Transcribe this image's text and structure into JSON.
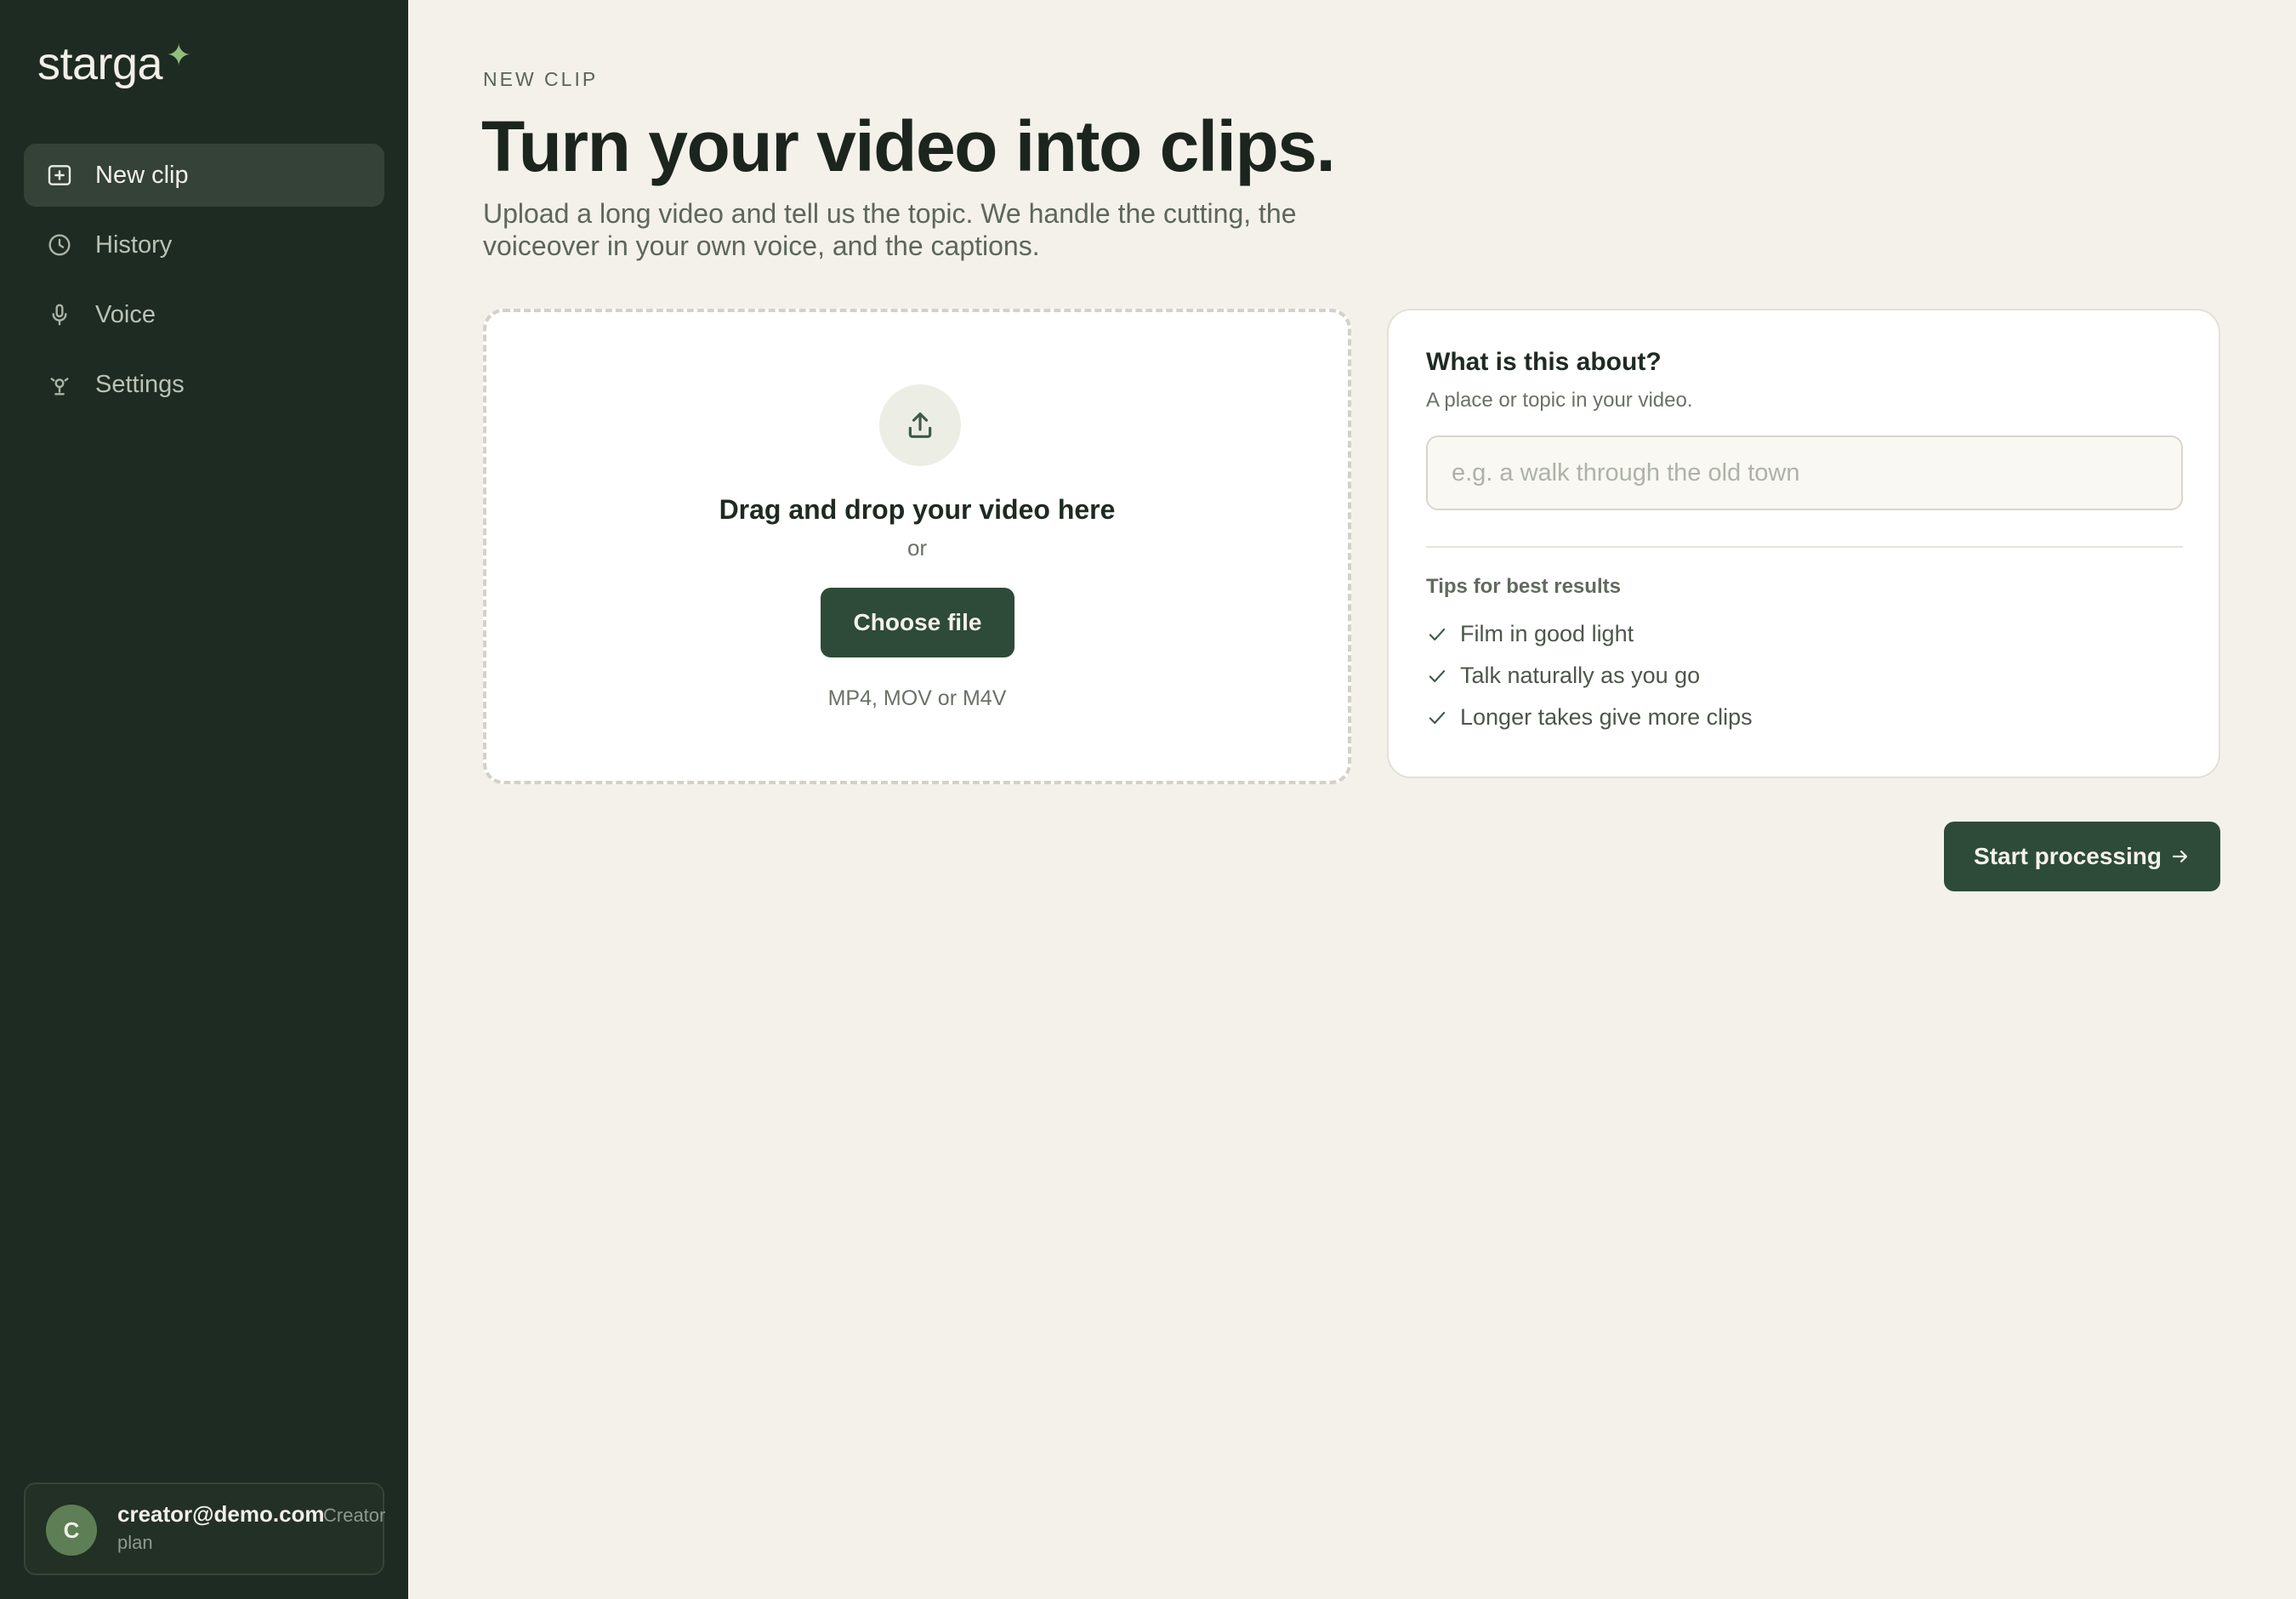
{
  "brand": {
    "name": "starga",
    "mark": "✦"
  },
  "sidebar": {
    "items": [
      {
        "label": "New clip",
        "icon": "plus-square-icon",
        "active": true
      },
      {
        "label": "History",
        "icon": "clock-icon",
        "active": false
      },
      {
        "label": "Voice",
        "icon": "microphone-icon",
        "active": false
      },
      {
        "label": "Settings",
        "icon": "settings-icon",
        "active": false
      }
    ]
  },
  "account": {
    "initial": "C",
    "email": "creator@demo.com",
    "plan_line1": "Creator",
    "plan_line2": "plan"
  },
  "main": {
    "eyebrow": "NEW CLIP",
    "title": "Turn your video into clips.",
    "subtitle": "Upload a long video and tell us the topic. We handle the cutting, the voiceover in your own voice, and the captions."
  },
  "dropzone": {
    "icon": "upload-icon",
    "title": "Drag and drop your video here",
    "or": "or",
    "button": "Choose file",
    "formats": "MP4, MOV or M4V"
  },
  "topic": {
    "question": "What is this about?",
    "hint": "A place or topic in your video.",
    "value": "",
    "placeholder": "e.g. a walk through the old town",
    "tips_title": "Tips for best results",
    "tips": [
      "Film in good light",
      "Talk naturally as you go",
      "Longer takes give more clips"
    ]
  },
  "actions": {
    "start": "Start processing"
  },
  "colors": {
    "sidebar_bg": "#1e2b22",
    "page_bg": "#f3f1ea",
    "accent": "#2e4a38",
    "brand_star": "#8fbf7c"
  }
}
